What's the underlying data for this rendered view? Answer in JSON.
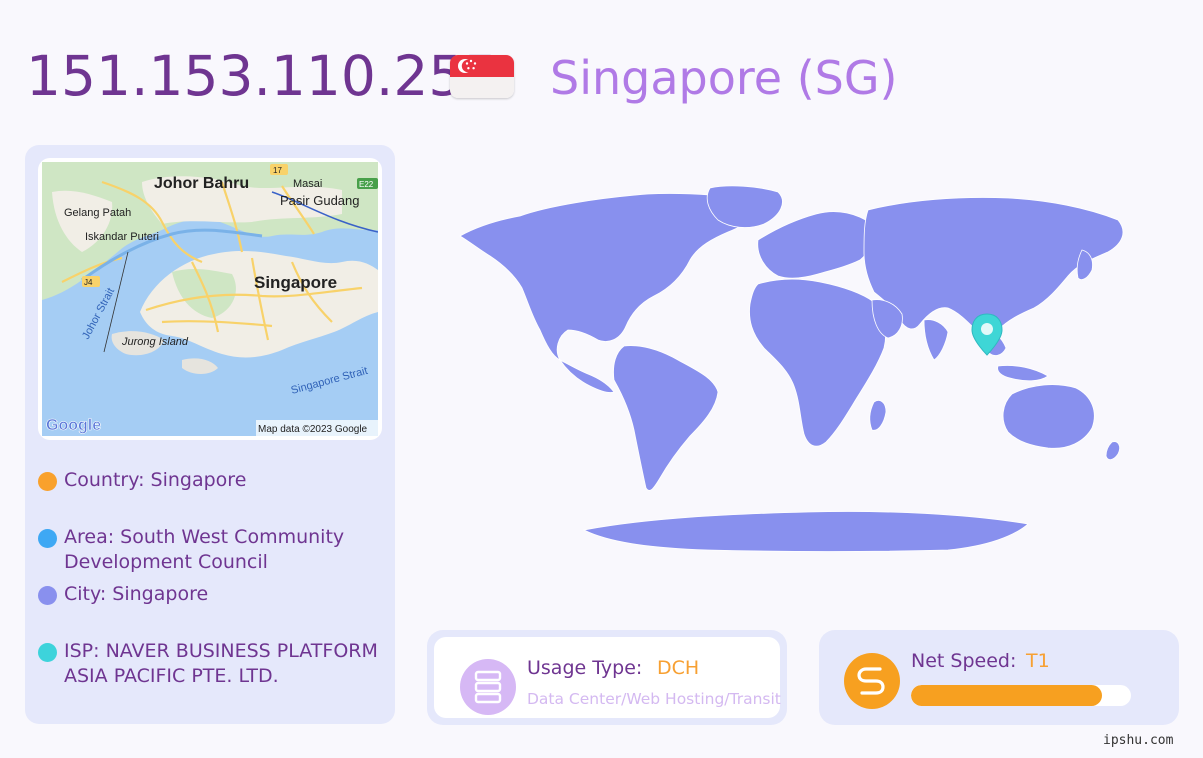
{
  "header": {
    "ip": "151.153.110.255",
    "country_title": "Singapore (SG)"
  },
  "flag": {
    "icon": "singapore-flag-icon",
    "top_color": "#ea3340",
    "bottom_color": "#f4f1f1"
  },
  "map": {
    "labels": {
      "johor_bahru": "Johor Bahru",
      "masai": "Masai",
      "pasir_gudang": "Pasir Gudang",
      "gelang_patah": "Gelang Patah",
      "iskandar_puteri": "Iskandar Puteri",
      "singapore": "Singapore",
      "johor_strait": "Johor Strait",
      "jurong_island": "Jurong Island",
      "singapore_strait": "Singapore Strait",
      "road_17": "17",
      "road_e22": "E22",
      "road_j4": "J4"
    },
    "logo": "Google",
    "attribution": "Map data ©2023 Google"
  },
  "info": {
    "country": "Country: Singapore",
    "area_line1": "Area: South West Community",
    "area_line2": "Development Council",
    "city": "City: Singapore",
    "isp_line1": "ISP: NAVER BUSINESS PLATFORM",
    "isp_line2": "ASIA PACIFIC PTE. LTD.",
    "colors": {
      "country": "#f9a12c",
      "area": "#3ea8f4",
      "city": "#8990ee",
      "isp": "#3dd3db"
    }
  },
  "world_map": {
    "land_color": "#8890ee",
    "pin_color": "#3ed6d6",
    "pin_icon": "location-pin-icon"
  },
  "usage": {
    "label": "Usage Type:",
    "value": "DCH",
    "description": "Data Center/Web Hosting/Transit",
    "icon": "server-icon"
  },
  "speed": {
    "label": "Net Speed:",
    "value": "T1",
    "level_percent": 87,
    "icon": "speed-icon"
  },
  "footer": {
    "watermark": "ipshu.com"
  }
}
